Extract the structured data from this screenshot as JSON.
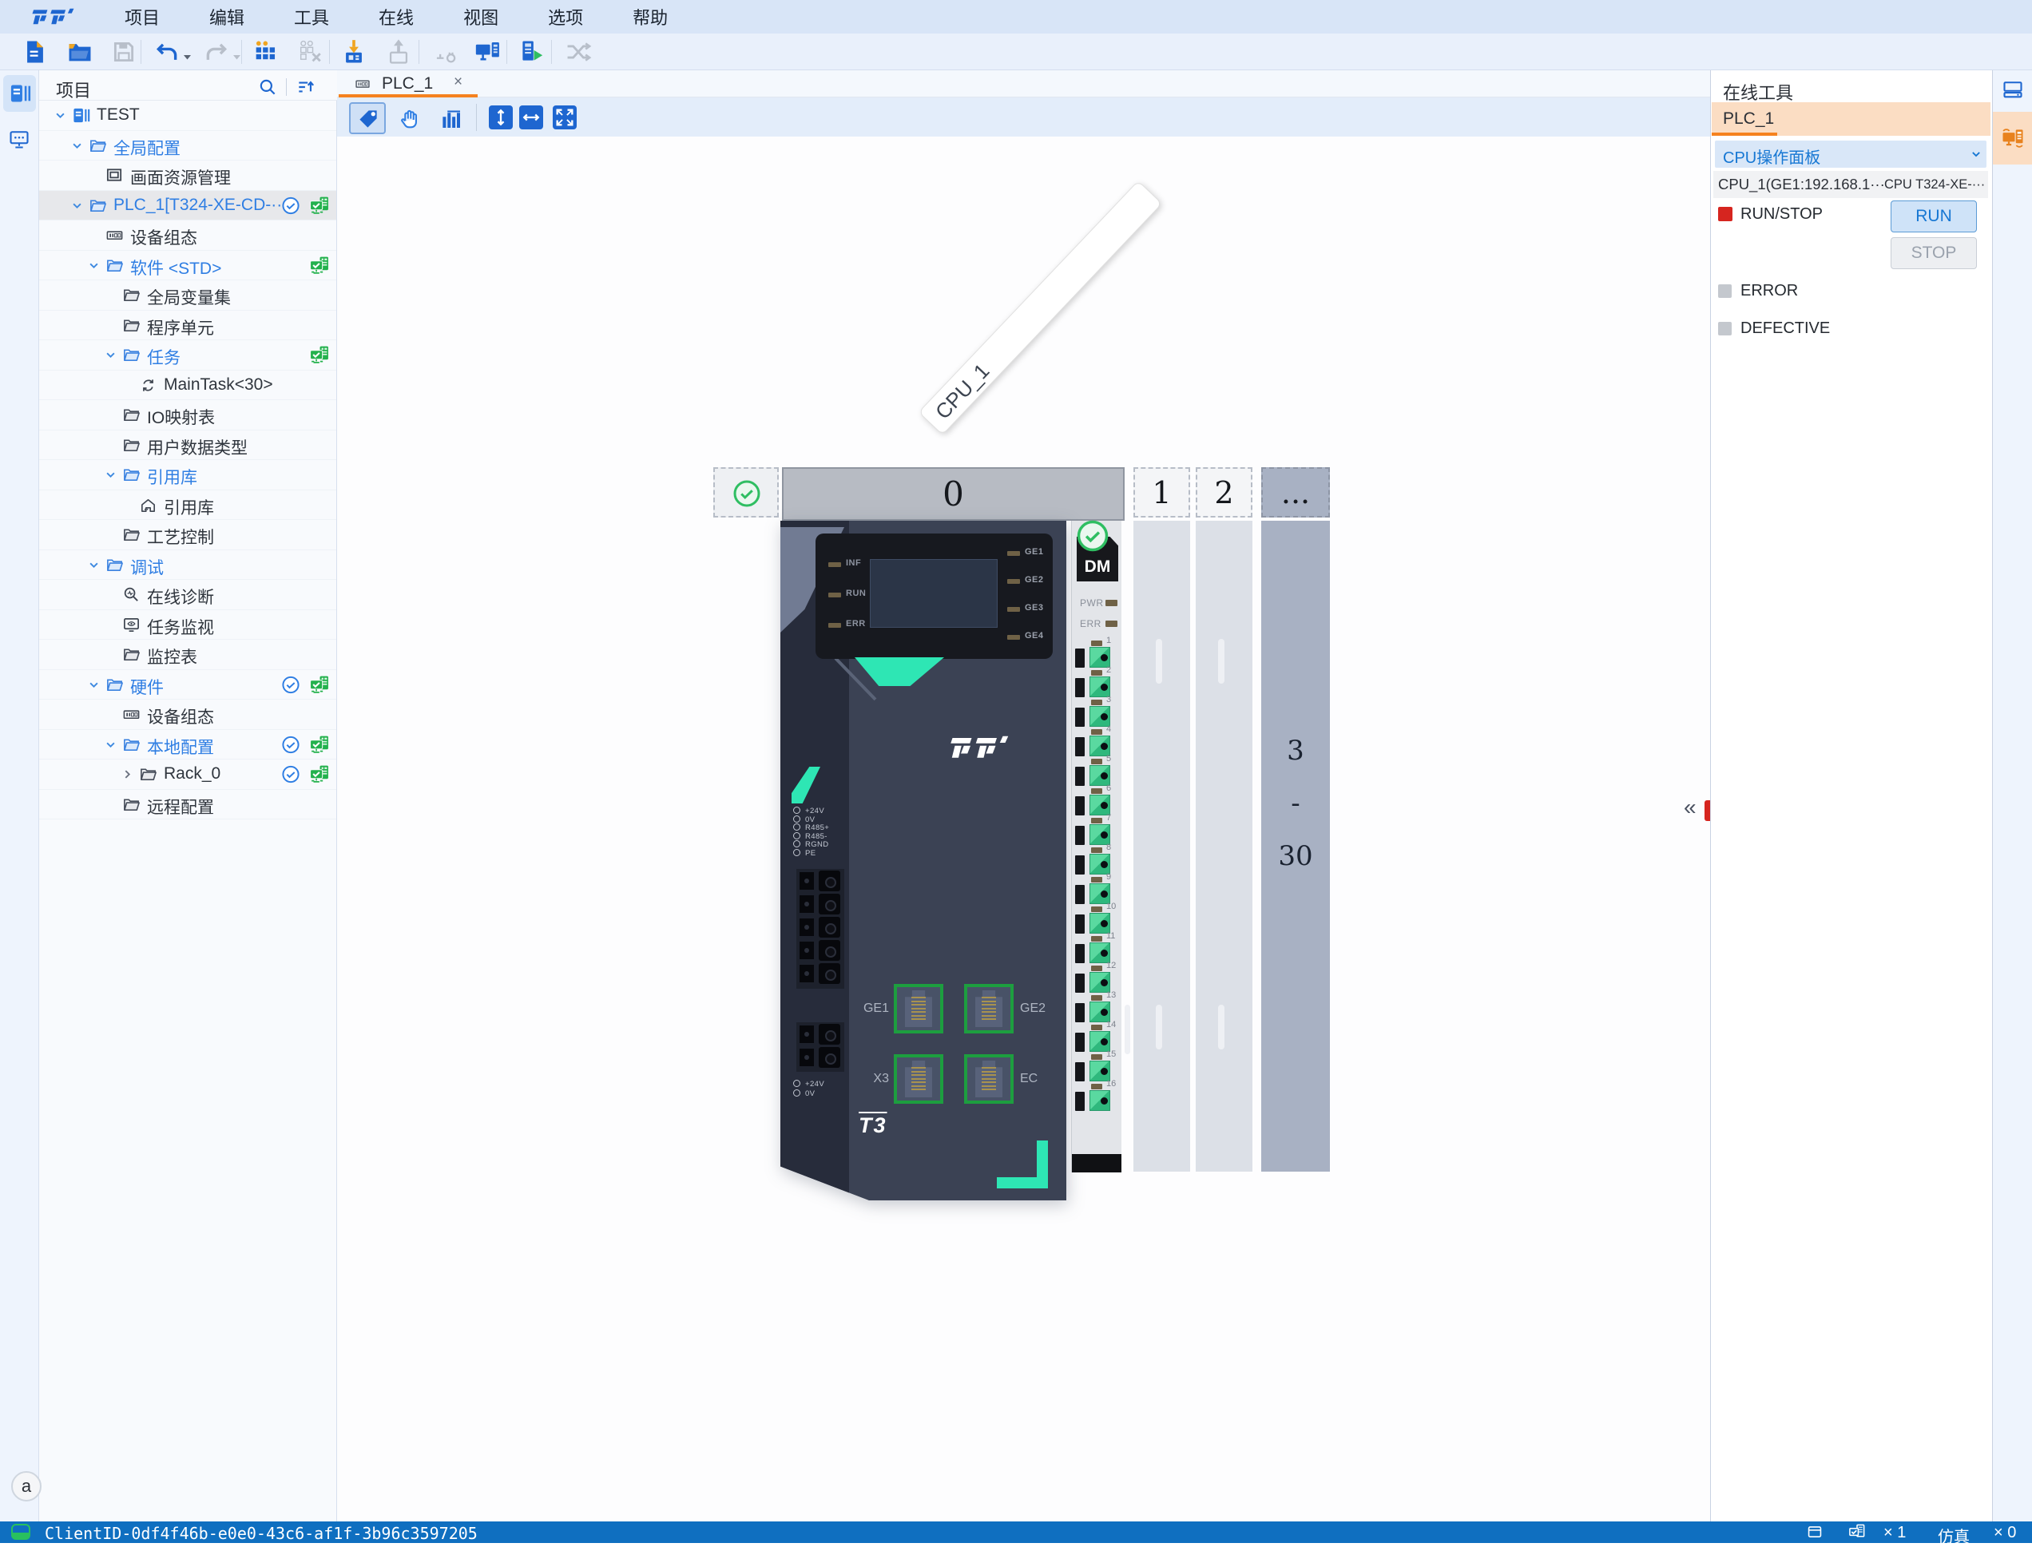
{
  "menu_bar": {
    "items": [
      "项目",
      "编辑",
      "工具",
      "在线",
      "视图",
      "选项",
      "帮助"
    ]
  },
  "toolbar": {
    "buttons": [
      {
        "name": "new-file",
        "enabled": true
      },
      {
        "name": "open-project",
        "enabled": true
      },
      {
        "name": "save",
        "enabled": false
      },
      {
        "name": "undo",
        "enabled": true,
        "caret": true
      },
      {
        "name": "redo",
        "enabled": false,
        "caret": true
      },
      {
        "name": "compile",
        "enabled": true
      },
      {
        "name": "clean",
        "enabled": false
      },
      {
        "name": "download-to-device",
        "enabled": true
      },
      {
        "name": "upload-from-device",
        "enabled": false
      },
      {
        "name": "connect-device",
        "enabled": false
      },
      {
        "name": "online-config",
        "enabled": true
      },
      {
        "name": "start-simulation",
        "enabled": true
      },
      {
        "name": "cross-reference",
        "enabled": false
      }
    ]
  },
  "activity_bar_left": {
    "items": [
      {
        "name": "project-explorer",
        "selected": true
      },
      {
        "name": "remote-devices",
        "selected": false
      }
    ]
  },
  "project_panel": {
    "title": "项目",
    "tree": [
      {
        "label": "TEST",
        "level": 0,
        "chevron": "down",
        "icon": "project",
        "color": "dark"
      },
      {
        "label": "全局配置",
        "level": 1,
        "chevron": "down",
        "icon": "folder",
        "color": "blue"
      },
      {
        "label": "画面资源管理",
        "level": 2,
        "icon": "screen",
        "color": "dark"
      },
      {
        "label": "PLC_1[T324-XE-CD-···",
        "level": 1,
        "chevron": "down",
        "icon": "folder",
        "color": "blue",
        "selected": true,
        "status": [
          "synced",
          "online"
        ]
      },
      {
        "label": "设备组态",
        "level": 2,
        "icon": "chip",
        "color": "dark"
      },
      {
        "label": "软件 <STD>",
        "level": 2,
        "chevron": "down",
        "icon": "folder",
        "color": "blue",
        "status": [
          "online"
        ]
      },
      {
        "label": "全局变量集",
        "level": 3,
        "icon": "folder-dark",
        "color": "dark"
      },
      {
        "label": "程序单元",
        "level": 3,
        "icon": "folder-dark",
        "color": "dark"
      },
      {
        "label": "任务",
        "level": 3,
        "chevron": "down",
        "icon": "folder",
        "color": "blue",
        "status": [
          "online"
        ]
      },
      {
        "label": "MainTask<30>",
        "level": 4,
        "icon": "task",
        "color": "dark"
      },
      {
        "label": "IO映射表",
        "level": 3,
        "icon": "folder-dark",
        "color": "dark"
      },
      {
        "label": "用户数据类型",
        "level": 3,
        "icon": "folder-dark",
        "color": "dark"
      },
      {
        "label": "引用库",
        "level": 3,
        "chevron": "down",
        "icon": "folder",
        "color": "blue"
      },
      {
        "label": "引用库",
        "level": 4,
        "icon": "library",
        "color": "dark"
      },
      {
        "label": "工艺控制",
        "level": 3,
        "icon": "folder-dark",
        "color": "dark"
      },
      {
        "label": "调试",
        "level": 2,
        "chevron": "down",
        "icon": "folder",
        "color": "blue"
      },
      {
        "label": "在线诊断",
        "level": 3,
        "icon": "diagnose",
        "color": "dark"
      },
      {
        "label": "任务监视",
        "level": 3,
        "icon": "watch",
        "color": "dark"
      },
      {
        "label": "监控表",
        "level": 3,
        "icon": "folder-dark",
        "color": "dark"
      },
      {
        "label": "硬件",
        "level": 2,
        "chevron": "down",
        "icon": "folder",
        "color": "blue",
        "status": [
          "synced",
          "online"
        ]
      },
      {
        "label": "设备组态",
        "level": 3,
        "icon": "chip",
        "color": "dark"
      },
      {
        "label": "本地配置",
        "level": 3,
        "chevron": "down",
        "icon": "folder",
        "color": "blue",
        "status": [
          "synced",
          "online"
        ]
      },
      {
        "label": "Rack_0",
        "level": 4,
        "chevron": "right",
        "icon": "folder-dark",
        "color": "dark",
        "status": [
          "synced",
          "online"
        ]
      },
      {
        "label": "远程配置",
        "level": 3,
        "icon": "folder-dark",
        "color": "dark"
      }
    ]
  },
  "document_tab": {
    "label": "PLC_1"
  },
  "canvas_tools": [
    {
      "name": "select-tag",
      "selected": true
    },
    {
      "name": "pan-hand",
      "selected": false
    },
    {
      "name": "statistics",
      "selected": false
    },
    {
      "name": "fit-vertical",
      "selected": false
    },
    {
      "name": "fit-horizontal",
      "selected": false
    },
    {
      "name": "fit-screen",
      "selected": false
    }
  ],
  "device_view": {
    "banner": "CPU_1",
    "rack_slots": [
      {
        "label": "0",
        "state": "occupied"
      },
      {
        "label": "1",
        "state": "empty"
      },
      {
        "label": "2",
        "state": "empty"
      },
      {
        "label": "...",
        "state": "more"
      }
    ],
    "slot_range": [
      "3",
      "-",
      "30"
    ],
    "module": {
      "status_leds": [
        "INF",
        "RUN",
        "ERR"
      ],
      "ge_leds": [
        "GE1",
        "GE2",
        "GE3",
        "GE4"
      ],
      "ports": [
        "GE1",
        "GE2",
        "X3",
        "EC"
      ],
      "comm_terminals": [
        "+24V",
        "0V",
        "R485+",
        "R485-",
        "RGND",
        "PE"
      ],
      "power_terminals": [
        "+24V",
        "0V"
      ],
      "model_mark": "T3",
      "dm": {
        "label": "DM",
        "leds": [
          "PWR",
          "ERR"
        ],
        "channels": [
          "1",
          "2",
          "3",
          "4",
          "5",
          "6",
          "7",
          "8",
          "9",
          "10",
          "11",
          "12",
          "13",
          "14",
          "15",
          "16"
        ]
      }
    }
  },
  "online_tools": {
    "title": "在线工具",
    "device_tab": "PLC_1",
    "section": "CPU操作面板",
    "cpu_endpoint": "CPU_1(GE1:192.168.1···",
    "cpu_model": "CPU T324-XE-···",
    "run_stop_label": "RUN/STOP",
    "run_button": "RUN",
    "stop_button": "STOP",
    "error_label": "ERROR",
    "defective_label": "DEFECTIVE"
  },
  "activity_bar_right": {
    "items": [
      {
        "name": "hardware-catalog",
        "selected": false
      },
      {
        "name": "online-tools",
        "selected": true
      }
    ]
  },
  "status_bar": {
    "client_id": "ClientID-0df4f46b-e0e0-43c6-af1f-3b96c3597205",
    "device_count": "× 1",
    "sim_label": "仿真",
    "sim_count": "× 0"
  },
  "user_badge": "a"
}
